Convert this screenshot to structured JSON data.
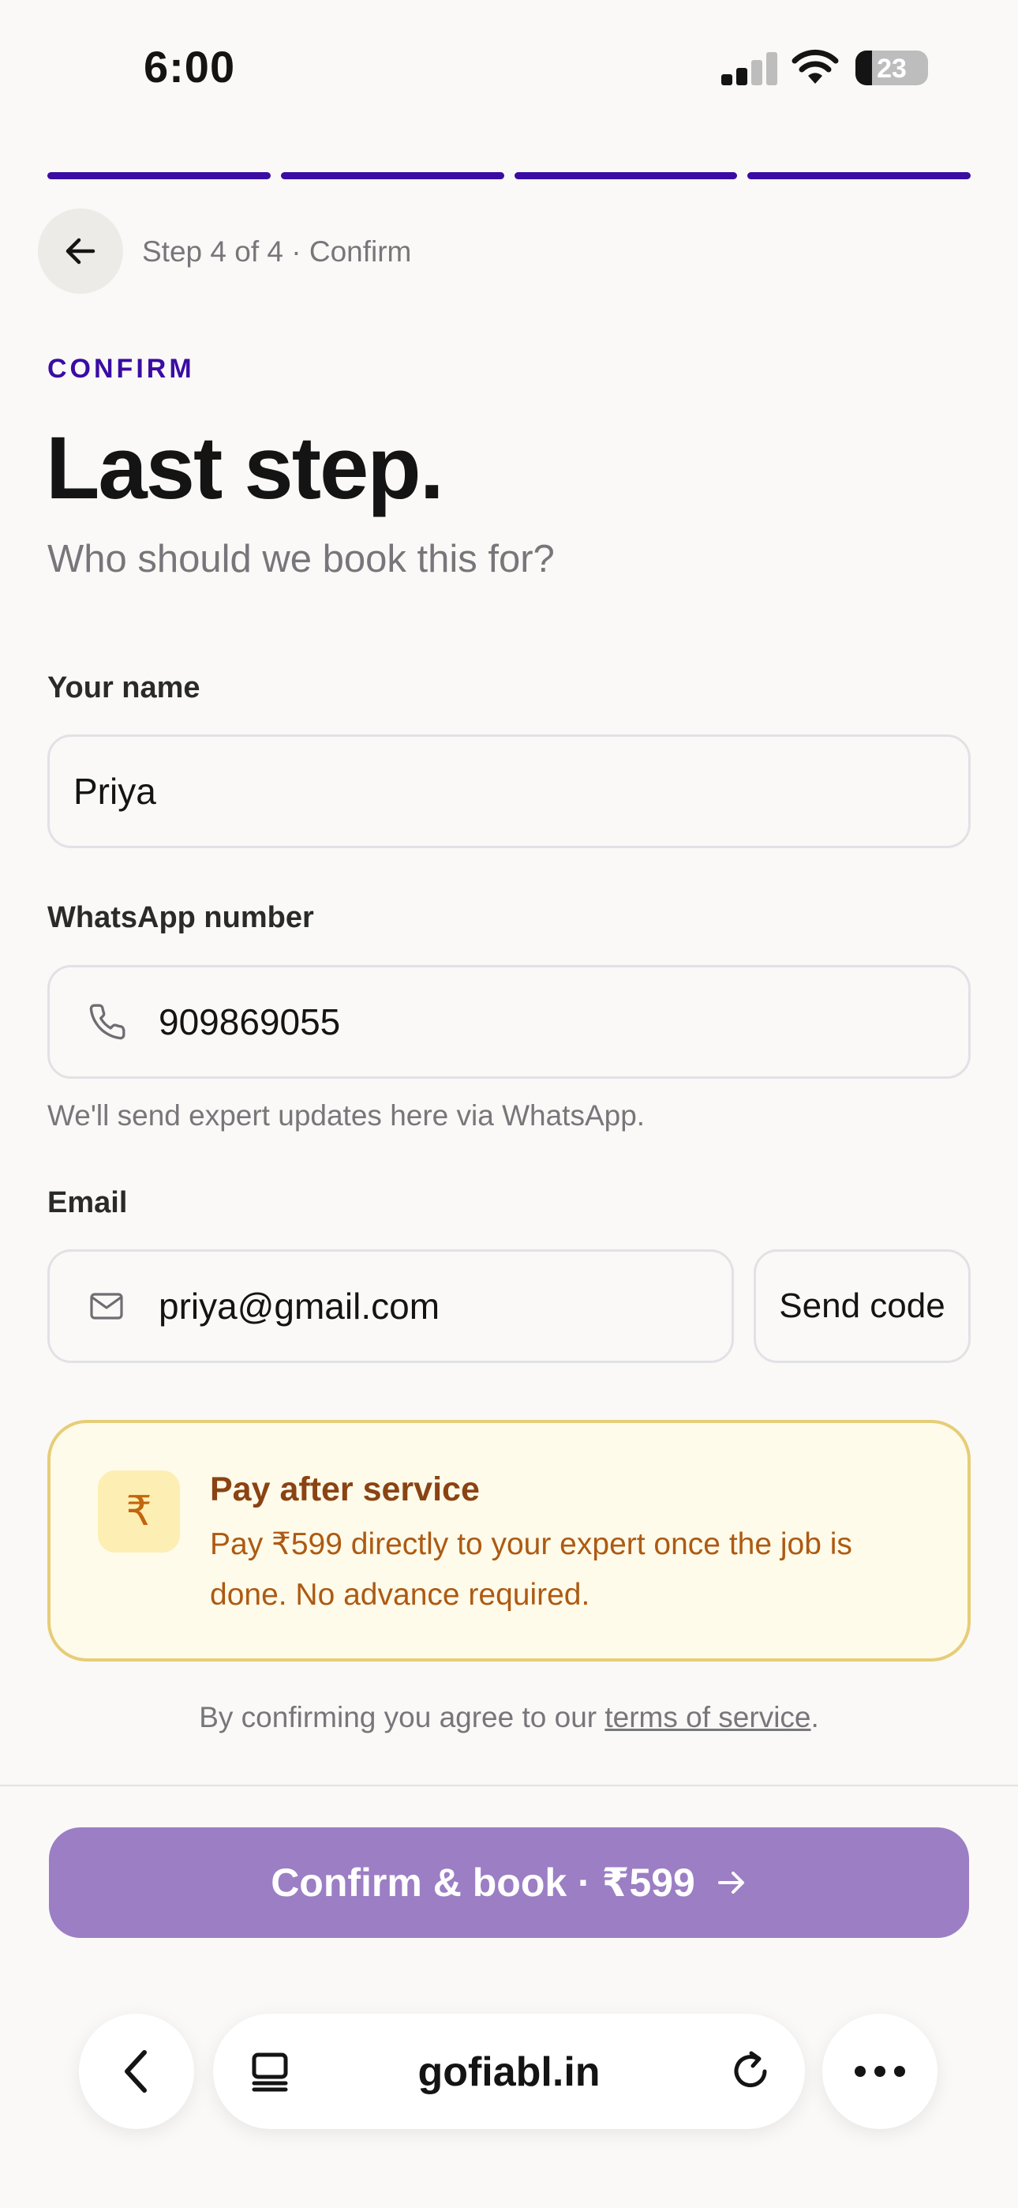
{
  "status_bar": {
    "time": "6:00",
    "battery": "23"
  },
  "progress": {
    "steps_total": 4,
    "steps_done": 4,
    "color": "#3a0ca3"
  },
  "header": {
    "step_label": "Step 4 of 4 · Confirm"
  },
  "page": {
    "eyebrow": "CONFIRM",
    "title": "Last step.",
    "subtitle": "Who should we book this for?"
  },
  "form": {
    "name": {
      "label": "Your name",
      "value": "Priya"
    },
    "whatsapp": {
      "label": "WhatsApp number",
      "value": "909869055",
      "hint": "We'll send expert updates here via WhatsApp.",
      "icon": "phone-icon"
    },
    "email": {
      "label": "Email",
      "value": "priya@gmail.com",
      "icon": "mail-icon",
      "send_code_label": "Send code"
    }
  },
  "notice": {
    "icon": "₹",
    "title": "Pay after service",
    "body": "Pay ₹599 directly to your expert once the job is done. No advance required."
  },
  "terms": {
    "prefix": "By confirming you agree to our ",
    "link": "terms of service",
    "suffix": "."
  },
  "cta": {
    "label": "Confirm & book · ₹599",
    "color": "#9b7ec4"
  },
  "browser": {
    "url": "gofiabl.in"
  }
}
